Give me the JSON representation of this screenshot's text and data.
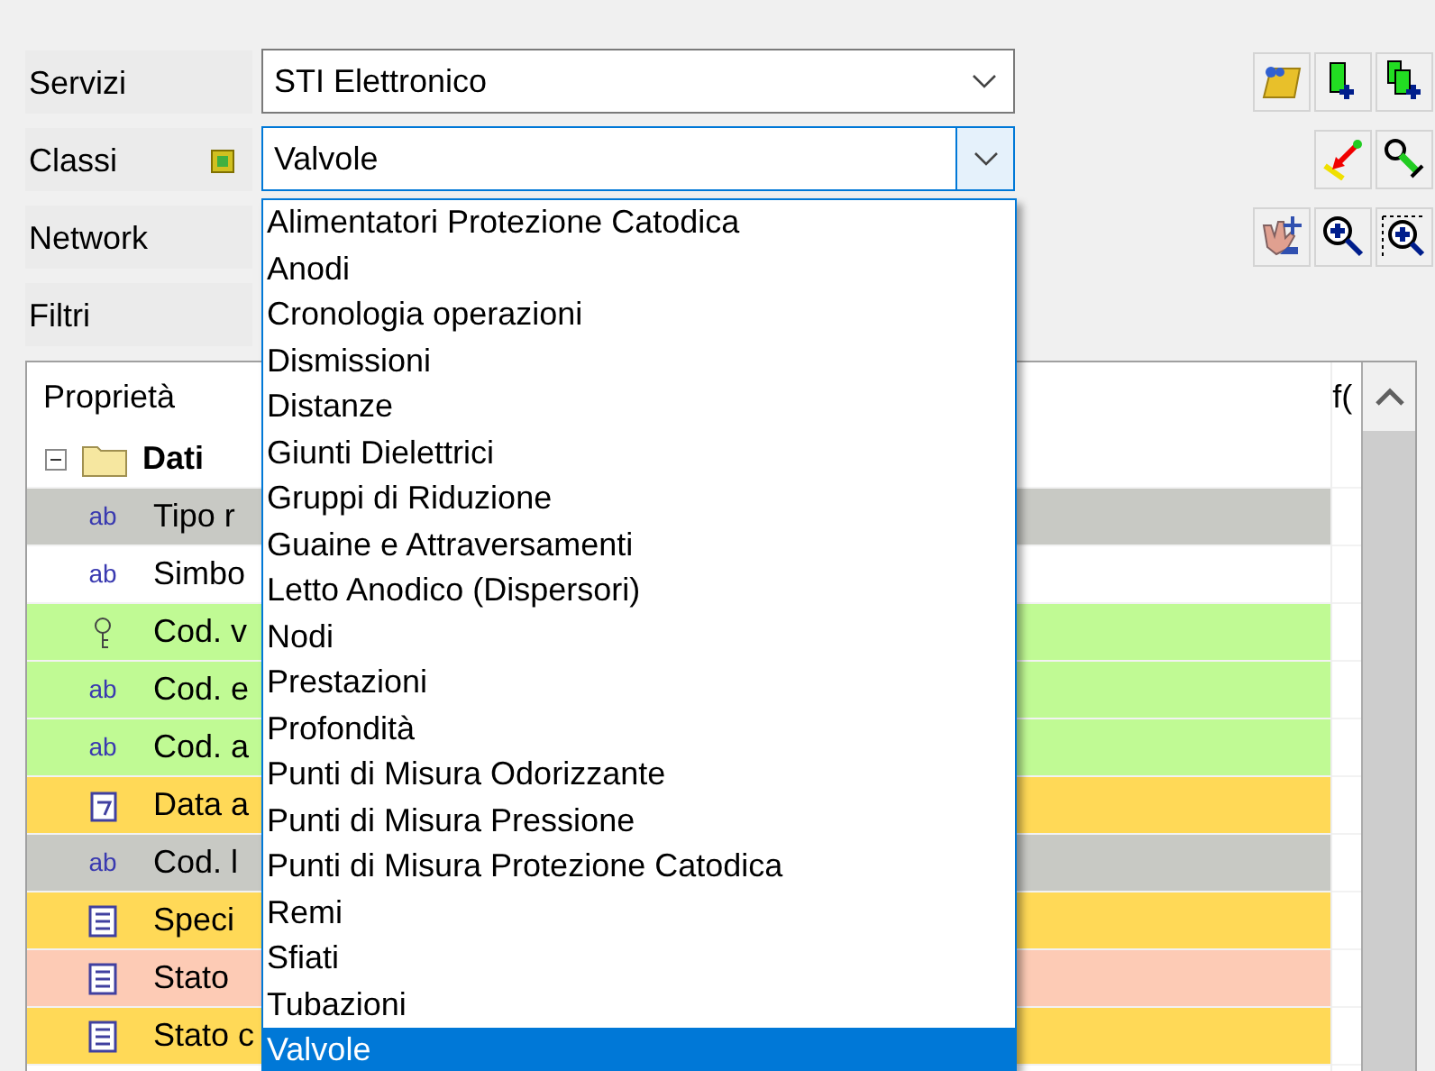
{
  "fields": [
    {
      "label": "Servizi",
      "value": "STI Elettronico",
      "focused": false
    },
    {
      "label": "Classi",
      "value": "Valvole",
      "focused": true
    },
    {
      "label": "Network"
    },
    {
      "label": "Filtri"
    }
  ],
  "dropdown": {
    "items": [
      {
        "label": "Alimentatori Protezione Catodica",
        "selected": false
      },
      {
        "label": "Anodi",
        "selected": false
      },
      {
        "label": "Cronologia operazioni",
        "selected": false
      },
      {
        "label": "Dismissioni",
        "selected": false
      },
      {
        "label": "Distanze",
        "selected": false
      },
      {
        "label": "Giunti Dielettrici",
        "selected": false
      },
      {
        "label": "Gruppi di Riduzione",
        "selected": false
      },
      {
        "label": "Guaine e Attraversamenti",
        "selected": false
      },
      {
        "label": "Letto Anodico (Dispersori)",
        "selected": false
      },
      {
        "label": "Nodi",
        "selected": false
      },
      {
        "label": "Prestazioni",
        "selected": false
      },
      {
        "label": "Profondità",
        "selected": false
      },
      {
        "label": "Punti di Misura Odorizzante",
        "selected": false
      },
      {
        "label": "Punti di Misura Pressione",
        "selected": false
      },
      {
        "label": "Punti di Misura Protezione Catodica",
        "selected": false
      },
      {
        "label": "Remi",
        "selected": false
      },
      {
        "label": "Sfiati",
        "selected": false
      },
      {
        "label": "Tubazioni",
        "selected": false
      },
      {
        "label": "Valvole",
        "selected": true
      }
    ]
  },
  "grid": {
    "columns": [
      "Proprietà",
      "f("
    ],
    "group": {
      "label": "Dati",
      "expanded": true
    },
    "rows": [
      {
        "label": "Tipo r",
        "kind": "text",
        "type_mark": "ab",
        "color": "#c8c9c4"
      },
      {
        "label": "Simbo",
        "kind": "text",
        "type_mark": "ab",
        "color": "#ffffff"
      },
      {
        "label": "Cod. v",
        "kind": "key",
        "color": "#c0fa94"
      },
      {
        "label": "Cod. e",
        "kind": "text",
        "type_mark": "ab",
        "color": "#c0fa94"
      },
      {
        "label": "Cod. a",
        "kind": "text",
        "type_mark": "ab",
        "color": "#c0fa94"
      },
      {
        "label": "Data a",
        "kind": "date",
        "color": "#ffd957"
      },
      {
        "label": "Cod. l",
        "kind": "text",
        "type_mark": "ab",
        "color": "#c8c9c4"
      },
      {
        "label": "Speci",
        "kind": "list",
        "color": "#ffd957"
      },
      {
        "label": "Stato",
        "kind": "list",
        "color": "#fdcbb5"
      },
      {
        "label": "Stato c",
        "kind": "list",
        "color": "#ffd957"
      }
    ]
  }
}
